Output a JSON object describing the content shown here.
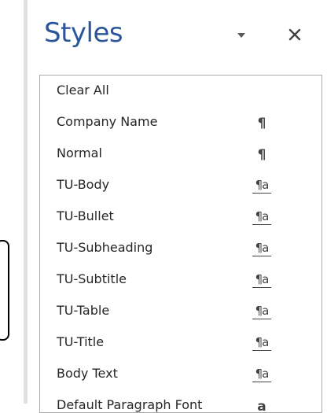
{
  "pane": {
    "title": "Styles",
    "options_icon": "dropdown-triangle-icon",
    "close_icon": "close-x-icon",
    "title_color": "#2b579a"
  },
  "styles": [
    {
      "name": "Clear All",
      "icon": "none"
    },
    {
      "name": "Company Name",
      "icon": "paragraph-mark-icon",
      "glyph": "¶"
    },
    {
      "name": "Normal",
      "icon": "paragraph-mark-icon",
      "glyph": "¶"
    },
    {
      "name": "TU-Body",
      "icon": "linked-style-icon",
      "glyph": "¶a"
    },
    {
      "name": "TU-Bullet",
      "icon": "linked-style-icon",
      "glyph": "¶a"
    },
    {
      "name": "TU-Subheading",
      "icon": "linked-style-icon",
      "glyph": "¶a"
    },
    {
      "name": "TU-Subtitle",
      "icon": "linked-style-icon",
      "glyph": "¶a"
    },
    {
      "name": "TU-Table",
      "icon": "linked-style-icon",
      "glyph": "¶a"
    },
    {
      "name": "TU-Title",
      "icon": "linked-style-icon",
      "glyph": "¶a"
    },
    {
      "name": "Body Text",
      "icon": "linked-style-icon",
      "glyph": "¶a"
    },
    {
      "name": "Default Paragraph Font",
      "icon": "character-style-icon",
      "glyph": "a"
    }
  ]
}
